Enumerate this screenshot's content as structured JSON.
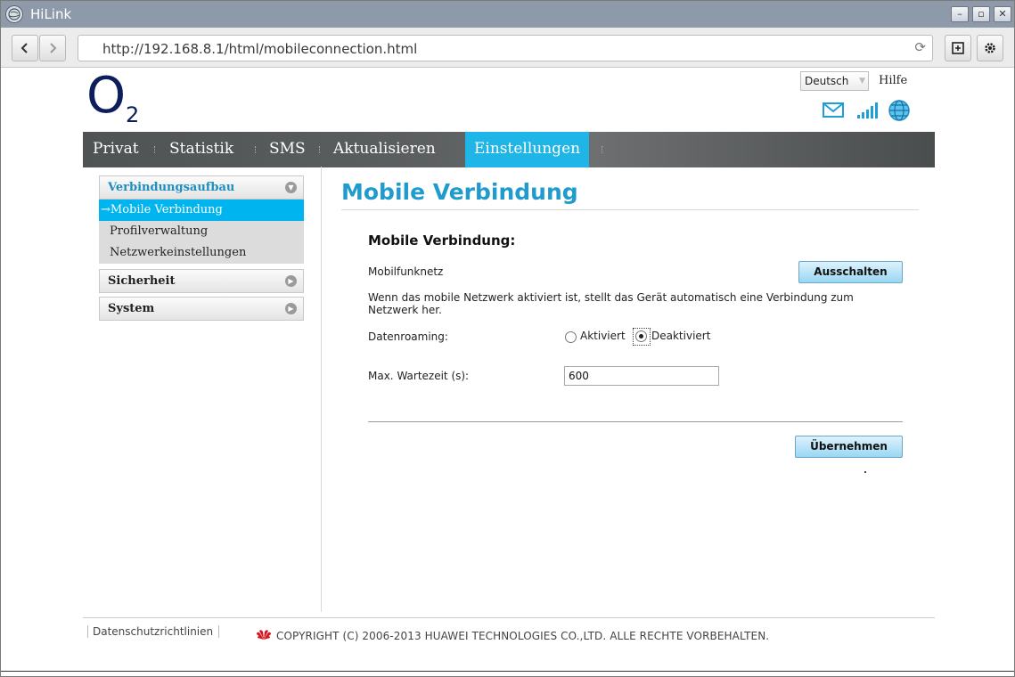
{
  "window": {
    "title": "HiLink"
  },
  "browser": {
    "url": "http://192.168.8.1/html/mobileconnection.html"
  },
  "header": {
    "logo_text": "O",
    "logo_sub": "2",
    "language": "Deutsch",
    "help": "Hilfe"
  },
  "nav": {
    "items": [
      {
        "label": "Privat"
      },
      {
        "label": "Statistik"
      },
      {
        "label": "SMS"
      },
      {
        "label": "Aktualisieren"
      },
      {
        "label": "Einstellungen"
      }
    ],
    "active": "Einstellungen"
  },
  "sidebar": {
    "groups": [
      {
        "label": "Verbindungsaufbau",
        "items": [
          {
            "label": "→Mobile Verbindung"
          },
          {
            "label": "Profilverwaltung"
          },
          {
            "label": "Netzwerkeinstellungen"
          }
        ]
      },
      {
        "label": "Sicherheit"
      },
      {
        "label": "System"
      }
    ]
  },
  "main": {
    "title": "Mobile Verbindung",
    "section_title": "Mobile Verbindung:",
    "mobile_network_label": "Mobilfunknetz",
    "toggle_button": "Ausschalten",
    "description": "Wenn das mobile Netzwerk aktiviert ist, stellt das Gerät automatisch eine Verbindung zum Netzwerk her.",
    "roaming_label": "Datenroaming:",
    "roaming_options": [
      "Aktiviert",
      "Deaktiviert"
    ],
    "roaming_selected": "Deaktiviert",
    "wait_label": "Max. Wartezeit (s):",
    "wait_value": "600",
    "apply_button": "Übernehmen"
  },
  "footer": {
    "privacy": "Datenschutzrichtlinien",
    "copyright": "COPYRIGHT (C) 2006-2013 HUAWEI TECHNOLOGIES CO.,LTD. ALLE RECHTE VORBEHALTEN."
  },
  "colors": {
    "accent": "#1fb5e6",
    "title_blue": "#1f9ccd",
    "brand": "#0e1d5c"
  }
}
